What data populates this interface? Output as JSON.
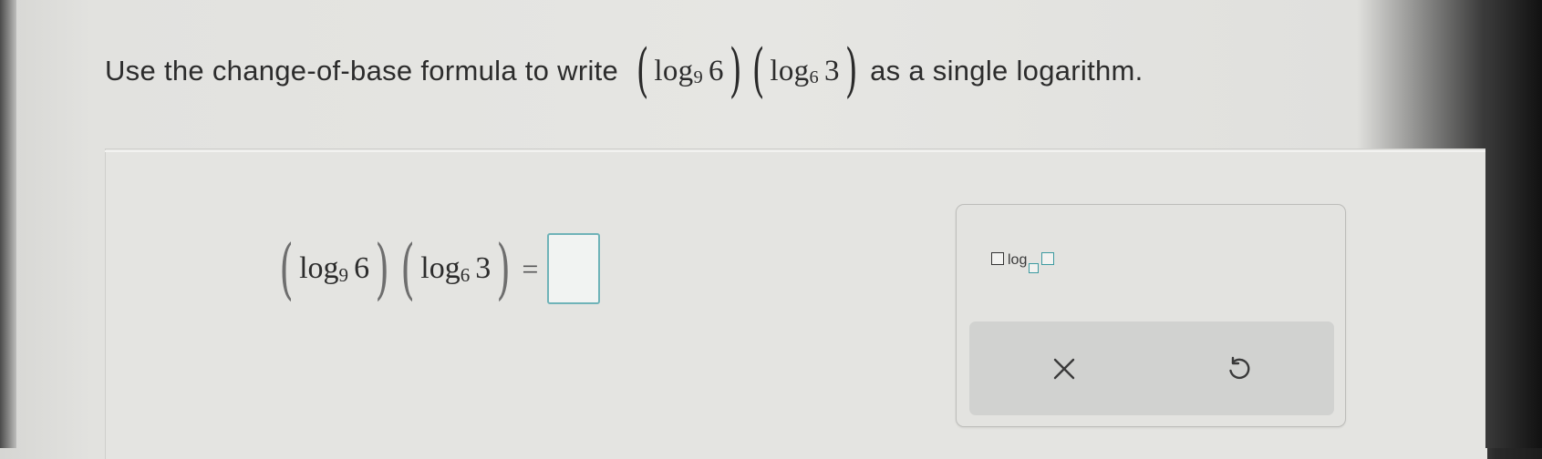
{
  "question": {
    "prefix": "Use the change-of-base formula to write",
    "suffix": "as a single logarithm.",
    "expr": {
      "log1_word": "log",
      "log1_base": "9",
      "log1_arg": "6",
      "log2_word": "log",
      "log2_base": "6",
      "log2_arg": "3"
    }
  },
  "answer": {
    "log1_word": "log",
    "log1_base": "9",
    "log1_arg": "6",
    "log2_word": "log",
    "log2_base": "6",
    "log2_arg": "3",
    "equals": "="
  },
  "palette": {
    "log_template_label": "log",
    "clear_icon": "x-icon",
    "undo_icon": "undo-icon"
  },
  "colors": {
    "answer_box_border": "#6fb3b8",
    "toolbar_bg": "#d1d2d0"
  }
}
